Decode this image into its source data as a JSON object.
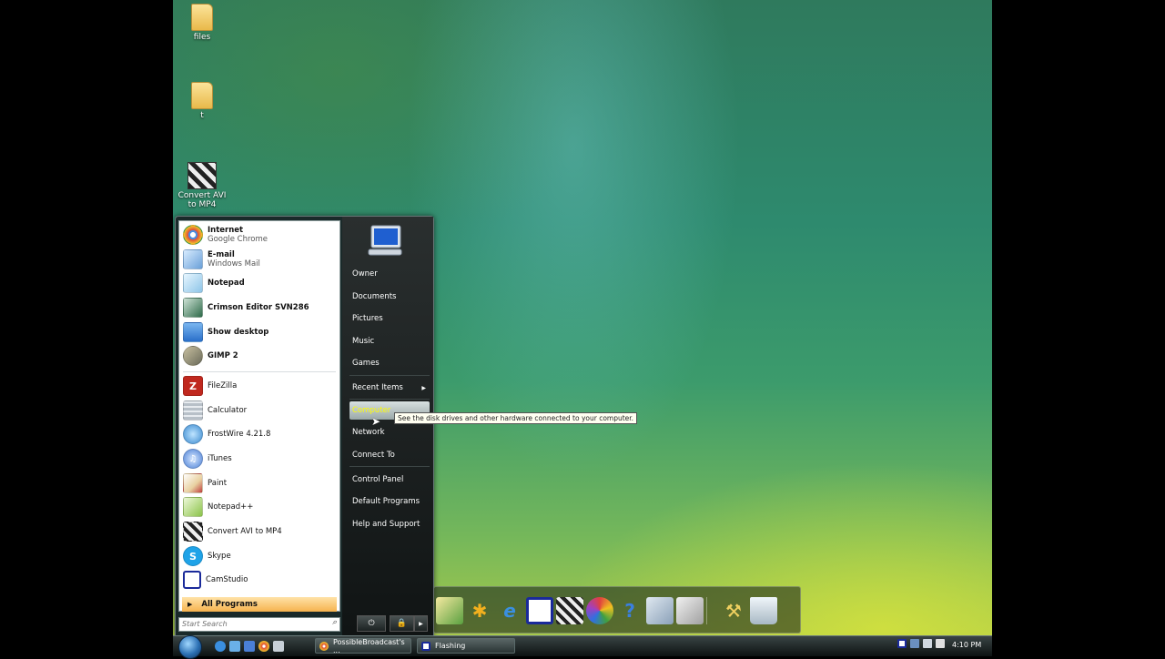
{
  "desktop": {
    "icons": [
      {
        "label": "files"
      },
      {
        "label": "t"
      },
      {
        "label": "Convert AVI to MP4"
      }
    ]
  },
  "start_menu": {
    "pinned": [
      {
        "name": "Internet",
        "sub": "Google Chrome",
        "color": "#e04a3a"
      },
      {
        "name": "E-mail",
        "sub": "Windows Mail",
        "color": "#6aa0d8"
      },
      {
        "name": "Notepad",
        "color": "#8ec5e8"
      },
      {
        "name": "Crimson Editor SVN286",
        "color": "#2f6b4a"
      },
      {
        "name": "Show desktop",
        "color": "#2a6fc9"
      },
      {
        "name": "GIMP 2",
        "color": "#6b6b5a"
      }
    ],
    "recent": [
      {
        "name": "FileZilla",
        "color": "#c0281e"
      },
      {
        "name": "Calculator",
        "color": "#b8c0c8"
      },
      {
        "name": "FrostWire 4.21.8",
        "color": "#3a8ad0"
      },
      {
        "name": "iTunes",
        "color": "#4a7fd6"
      },
      {
        "name": "Paint",
        "color": "#e8d0a0"
      },
      {
        "name": "Notepad++",
        "color": "#8bc34a"
      },
      {
        "name": "Convert AVI to MP4",
        "color": "#444444"
      },
      {
        "name": "Skype",
        "color": "#1fa3e8"
      },
      {
        "name": "CamStudio",
        "color": "#1a2a9a"
      }
    ],
    "all_programs": "All Programs",
    "search_placeholder": "Start Search",
    "right_items": {
      "owner": "Owner",
      "documents": "Documents",
      "pictures": "Pictures",
      "music": "Music",
      "games": "Games",
      "recent_items": "Recent Items",
      "computer": "Computer",
      "network": "Network",
      "connect_to": "Connect To",
      "control_panel": "Control Panel",
      "default_programs": "Default Programs",
      "help_support": "Help and Support"
    },
    "tooltip": "See the disk drives and other hardware connected to your computer."
  },
  "taskbar": {
    "tasks": [
      {
        "label": "PossibleBroadcast's ..."
      },
      {
        "label": "Flashing"
      }
    ],
    "clock": "4:10 PM"
  },
  "colors": {
    "accent_orange": "#f6b24e",
    "selected_text": "#ffff00"
  }
}
